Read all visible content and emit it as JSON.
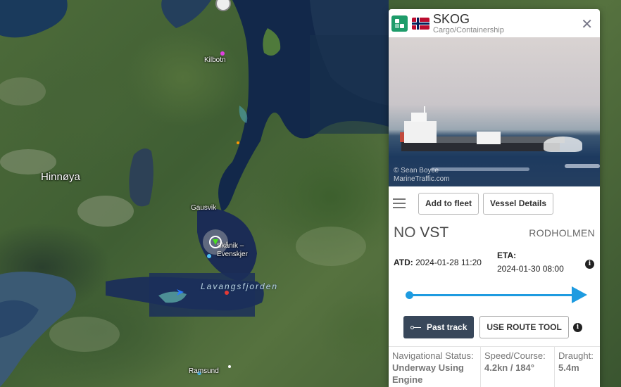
{
  "map": {
    "places": {
      "hinnoya": "Hinnøya",
      "kilbotn": "Kilbotn",
      "gausvik": "Gausvik",
      "evenskjer": "Skånik –\nEvenskjer",
      "fjord": "Lavangsfjorden",
      "ramsund": "Ramsund"
    }
  },
  "vessel": {
    "name": "SKOG",
    "type": "Cargo/Containership",
    "flag_icon": "norway-flag",
    "photo_credit_line1": "© Sean Boyce",
    "photo_credit_line2": "MarineTraffic.com",
    "add_fleet_label": "Add to fleet",
    "details_label": "Vessel Details",
    "callsign_prefix": "NO",
    "callsign": "VST",
    "destination": "RODHOLMEN",
    "atd_label": "ATD:",
    "atd_value": "2024-01-28 11:20",
    "eta_label": "ETA:",
    "eta_value": "2024-01-30 08:00",
    "past_track_label": "Past track",
    "route_tool_label": "USE ROUTE TOOL",
    "nav_status_label": "Navigational Status:",
    "nav_status_value": "Underway Using Engine",
    "speed_label": "Speed/Course:",
    "speed_value": "4.2kn / 184°",
    "draught_label": "Draught:",
    "draught_value": "5.4m"
  },
  "colors": {
    "accent": "#1e9be0",
    "vessel_icon": "#1e9c6a",
    "dark_button": "#38475a"
  }
}
